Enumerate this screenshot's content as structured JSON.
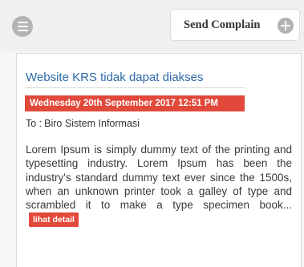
{
  "toolbar": {
    "menu_icon": "hamburger-menu-icon",
    "send_button_label": "Send Complain",
    "send_button_icon": "plus-circle-icon"
  },
  "complaint": {
    "title": "Website KRS tidak dapat diakses",
    "date": "Wednesday 20th September 2017 12:51 PM",
    "recipient_prefix": "To :",
    "recipient": "Biro Sistem Informasi",
    "body": "Lorem Ipsum is simply dummy text of the printing and typesetting industry. Lorem Ipsum has been the industry's standard dummy text ever since the 1500s, when an unknown printer took a galley of type and scrambled it to make a type specimen book...",
    "read_more_label": "lihat detail"
  },
  "colors": {
    "accent_red": "#e1493a",
    "title_blue": "#2d6aa8",
    "icon_grey": "#b4b4b4"
  }
}
